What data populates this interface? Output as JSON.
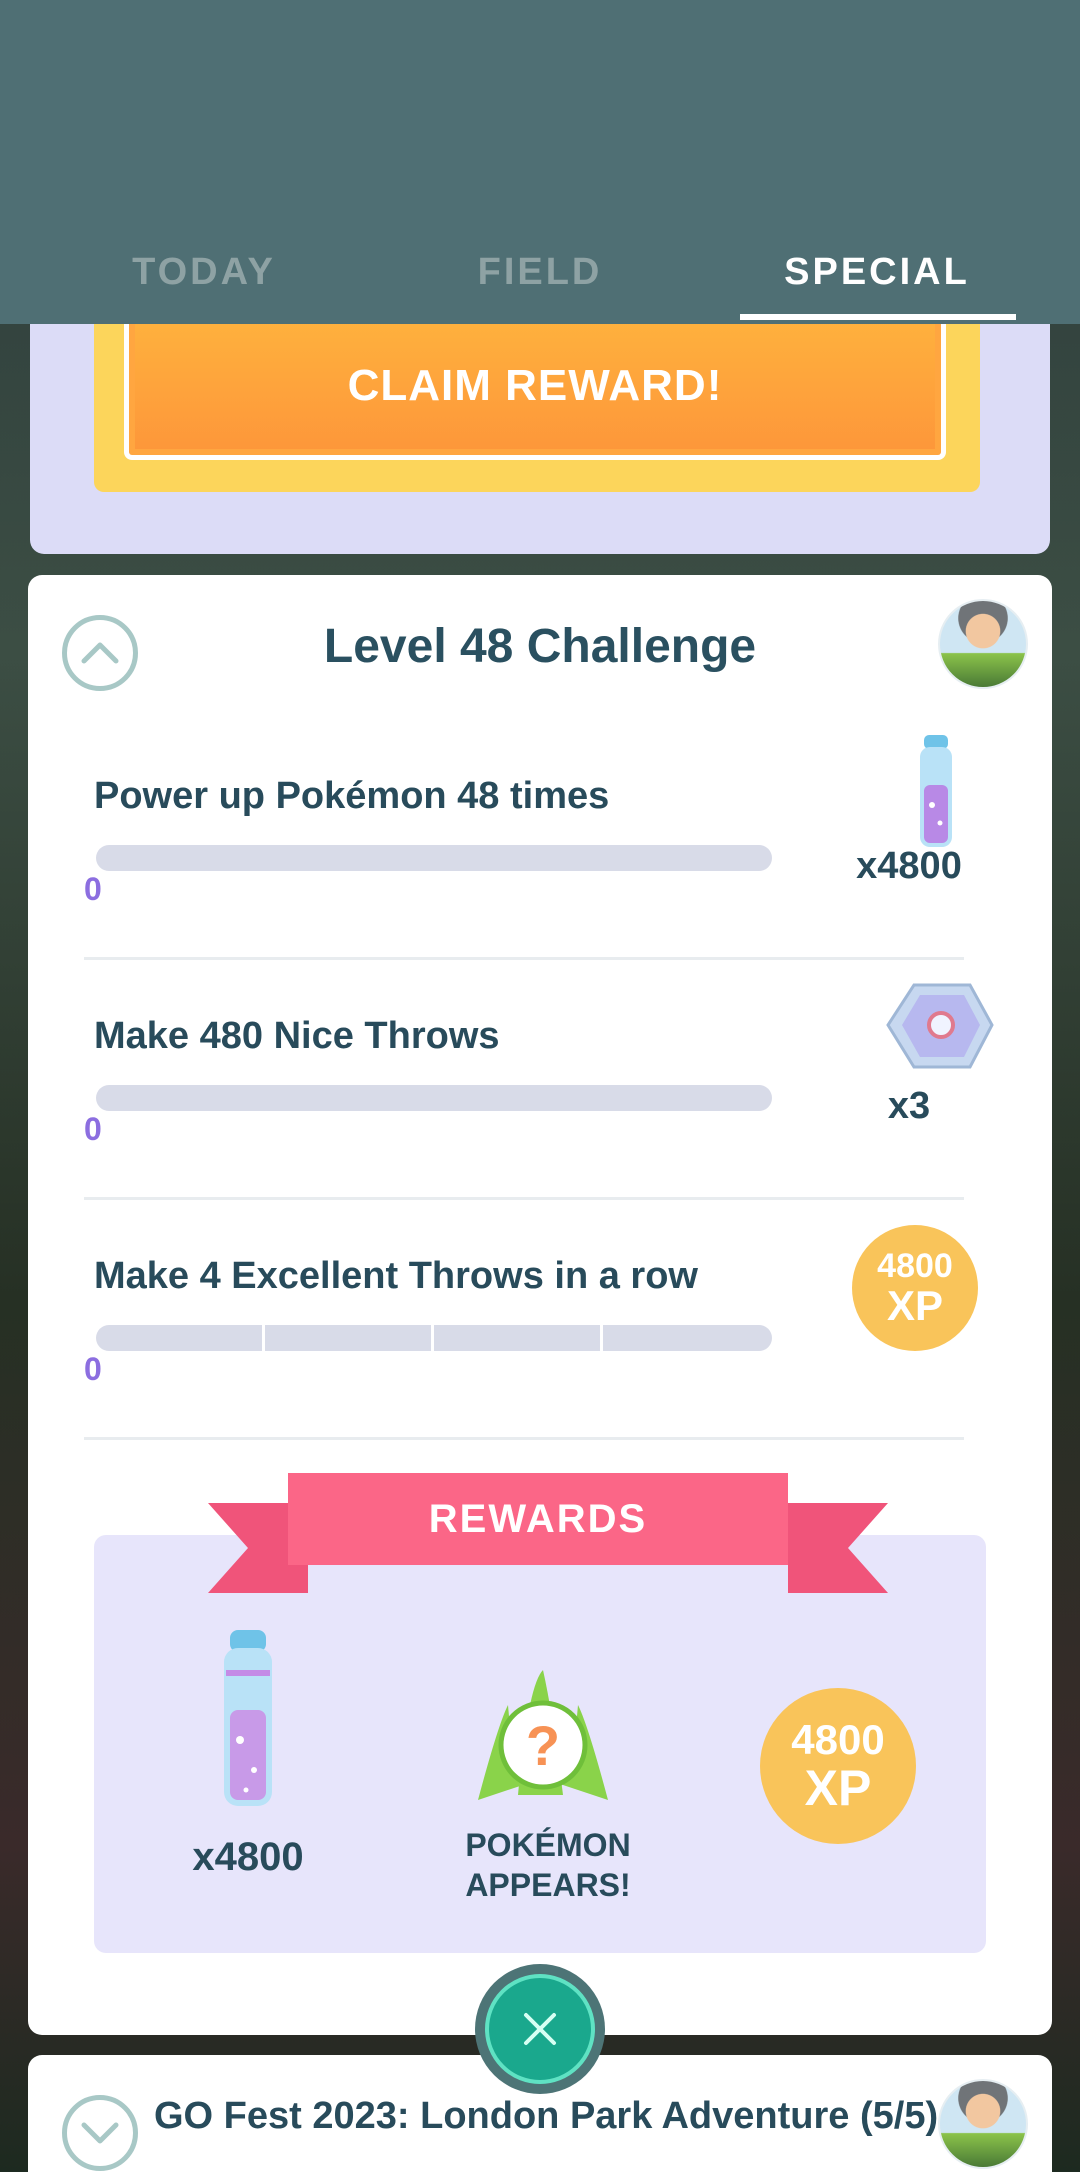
{
  "tabs": [
    {
      "label": "TODAY"
    },
    {
      "label": "FIELD"
    },
    {
      "label": "SPECIAL"
    }
  ],
  "active_tab": "SPECIAL",
  "claim_button_label": "CLAIM REWARD!",
  "challenge": {
    "title": "Level 48 Challenge",
    "tasks": [
      {
        "label": "Power up Pokémon 48 times",
        "progress": "0",
        "reward_qty": "x4800",
        "reward_icon": "stardust-icon"
      },
      {
        "label": "Make 480 Nice Throws",
        "progress": "0",
        "reward_qty": "x3",
        "reward_icon": "lure-module-icon"
      },
      {
        "label": "Make 4 Excellent Throws in a row",
        "progress": "0",
        "reward_xp_value": "4800",
        "reward_xp_unit": "XP"
      }
    ],
    "rewards_heading": "REWARDS",
    "rewards": {
      "stardust_qty": "x4800",
      "encounter_line1": "POKÉMON",
      "encounter_line2": "APPEARS!",
      "xp_value": "4800",
      "xp_unit": "XP"
    }
  },
  "next_card": {
    "title": "GO Fest 2023: London Park Adventure (5/5)"
  },
  "colors": {
    "header": "#4f6f74",
    "accent_pink": "#fb6687",
    "xp_gold": "#f9c45a",
    "progress_value": "#8c6ee0"
  }
}
